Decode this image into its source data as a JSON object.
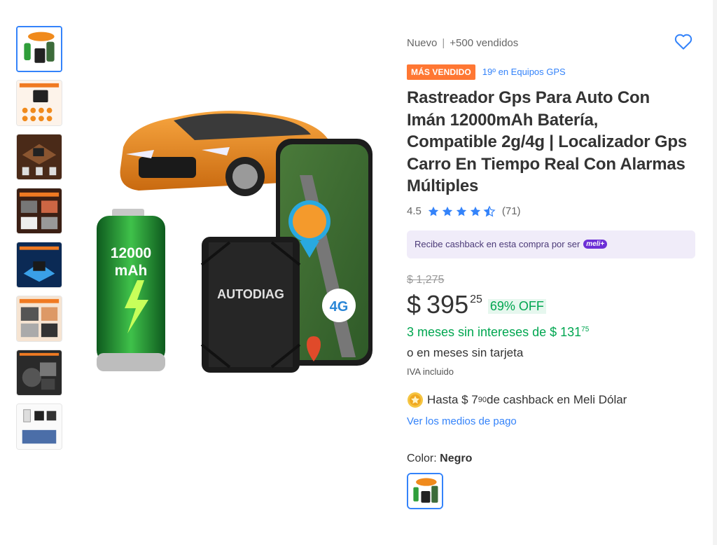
{
  "product": {
    "condition": "Nuevo",
    "separator": "|",
    "sold": "+500 vendidos",
    "badge": "MÁS VENDIDO",
    "rank": "19º en Equipos GPS",
    "title": "Rastreador Gps Para Auto Con Imán 12000mAh Batería, Compatible 2g/4g | Localizador Gps Carro En Tiempo Real Con Alarmas Múltiples",
    "rating_value": "4.5",
    "rating_stars": 4.5,
    "rating_count": "(71)",
    "cashback_text": "Recibe cashback en esta compra por ser",
    "meli_plus": "meli+",
    "old_price": "$ 1,275",
    "currency": "$",
    "price": "395",
    "price_cents": "25",
    "discount": "69% OFF",
    "installments_text": "3 meses sin intereses de $ 131",
    "installments_cents": "75",
    "no_card": "o en meses sin tarjeta",
    "iva": "IVA incluido",
    "coin_text_1": "Hasta $ 7",
    "coin_cents": "90",
    "coin_text_2": " de cashback en Meli Dólar",
    "payment_link": "Ver los medios de pago",
    "color_label": "Color:",
    "color_value": "Negro"
  },
  "image": {
    "battery_line1": "12000",
    "battery_line2": "mAh",
    "device_label": "AUTODIAG",
    "network_label": "4G"
  },
  "colors": {
    "accent": "#3483fa",
    "green": "#00a650",
    "orange": "#ff7733",
    "star": "#3483fa"
  },
  "thumbnails": [
    {
      "icon": "product-main-thumb"
    },
    {
      "icon": "features-thumb"
    },
    {
      "icon": "installation-thumb"
    },
    {
      "icon": "alerts-thumb"
    },
    {
      "icon": "battery-thumb"
    },
    {
      "icon": "usage-thumb"
    },
    {
      "icon": "car-install-thumb"
    },
    {
      "icon": "package-thumb"
    }
  ]
}
